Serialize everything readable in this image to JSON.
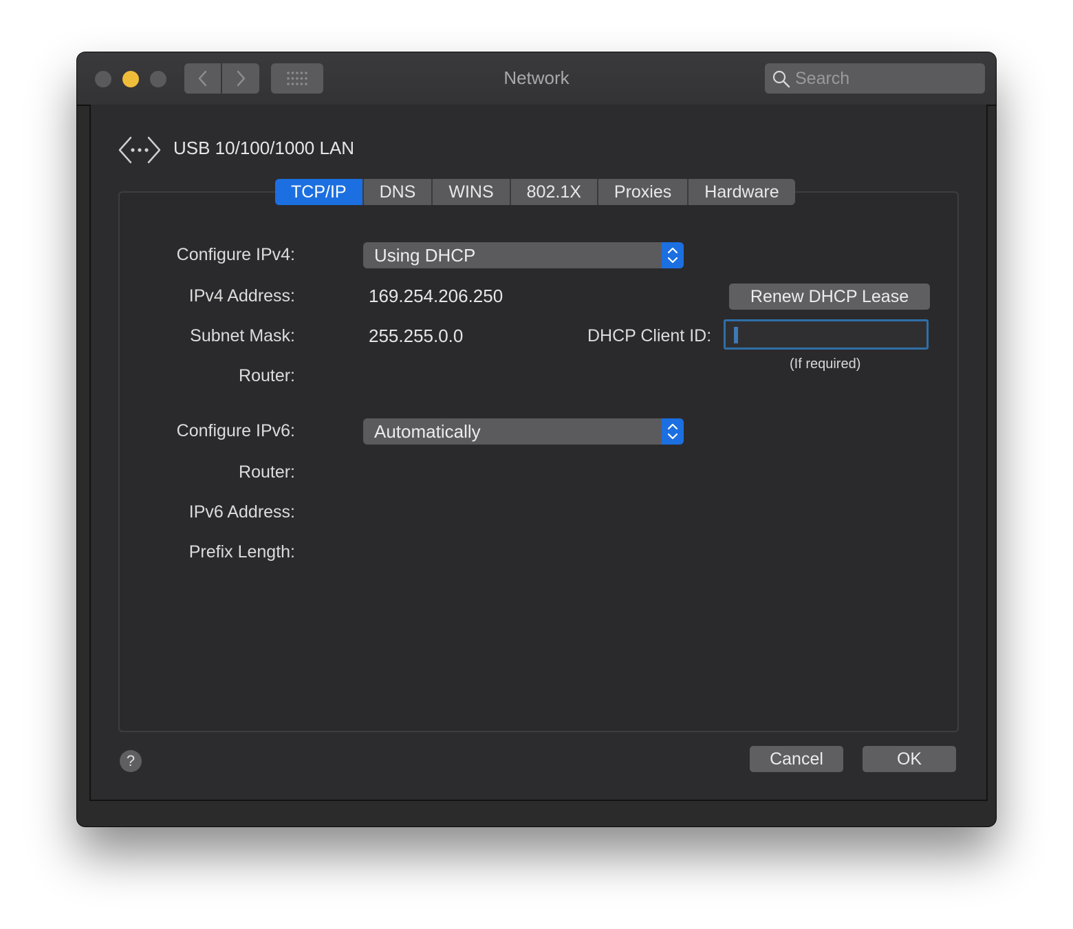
{
  "window": {
    "title": "Network",
    "search": {
      "placeholder": "Search"
    }
  },
  "interface": {
    "name": "USB 10/100/1000 LAN"
  },
  "tabs": [
    {
      "label": "TCP/IP",
      "active": true
    },
    {
      "label": "DNS",
      "active": false
    },
    {
      "label": "WINS",
      "active": false
    },
    {
      "label": "802.1X",
      "active": false
    },
    {
      "label": "Proxies",
      "active": false
    },
    {
      "label": "Hardware",
      "active": false
    }
  ],
  "ipv4": {
    "configure_label": "Configure IPv4:",
    "configure_value": "Using DHCP",
    "address_label": "IPv4 Address:",
    "address_value": "169.254.206.250",
    "subnet_label": "Subnet Mask:",
    "subnet_value": "255.255.0.0",
    "router_label": "Router:",
    "router_value": "",
    "renew_button": "Renew DHCP Lease",
    "client_id_label": "DHCP Client ID:",
    "client_id_value": "",
    "client_id_hint": "(If required)"
  },
  "ipv6": {
    "configure_label": "Configure IPv6:",
    "configure_value": "Automatically",
    "router_label": "Router:",
    "router_value": "",
    "address_label": "IPv6 Address:",
    "address_value": "",
    "prefix_label": "Prefix Length:",
    "prefix_value": ""
  },
  "footer": {
    "help_label": "?",
    "cancel_label": "Cancel",
    "ok_label": "OK"
  },
  "colors": {
    "accent": "#1c6fe0",
    "window_bg": "#2b2b2c",
    "minimize": "#f0bd3b"
  }
}
